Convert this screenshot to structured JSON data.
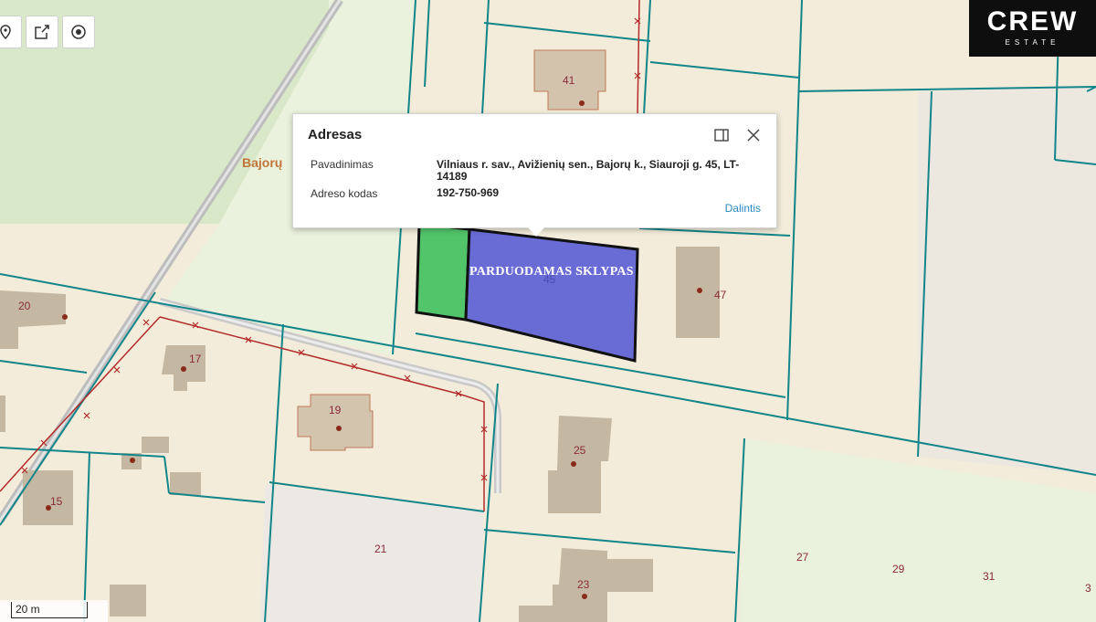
{
  "map": {
    "road_label": "Bajorų",
    "plot_label": "PARDUODAMAS SKLYPAS",
    "scale_label": "20 m",
    "colors": {
      "background": "#f3ecda",
      "parcel_line": "#11858a",
      "building": "#c4b8a2",
      "green_area": "#d8e8c8",
      "road": "#b7b7b7",
      "selected_plot": "#6a6cd6",
      "green_plot": "#52c46a",
      "boundary_red": "#b32b2b"
    },
    "house_numbers": {
      "n41": "41",
      "n45": "45",
      "n47": "47",
      "n20": "20",
      "n17": "17",
      "n19": "19",
      "n25": "25",
      "n15": "15",
      "n21": "21",
      "n23": "23",
      "n27": "27",
      "n29": "29",
      "n31": "31",
      "n3": "3"
    }
  },
  "toolbar": {
    "icons": [
      "map-pin-icon",
      "share-export-icon",
      "target-icon"
    ]
  },
  "logo": {
    "brand": "CREW",
    "sub": "ESTATE"
  },
  "popup": {
    "title": "Adresas",
    "name_label": "Pavadinimas",
    "name_value": "Vilniaus r. sav., Avižienių sen., Bajorų k., Siauroji g. 45, LT-14189",
    "code_label": "Adreso kodas",
    "code_value": "192-750-969",
    "share_label": "Dalintis"
  }
}
